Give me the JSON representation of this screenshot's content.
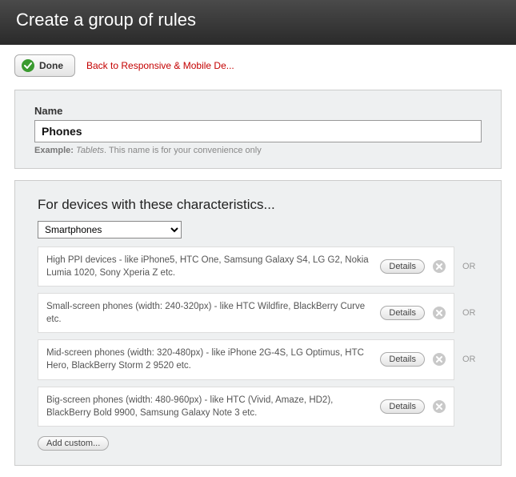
{
  "header": {
    "title": "Create a group of rules"
  },
  "toolbar": {
    "done_label": "Done",
    "back_label": "Back to Responsive & Mobile De..."
  },
  "name_panel": {
    "label": "Name",
    "value": "Phones",
    "hint_prefix": "Example:",
    "hint_example": "Tablets",
    "hint_suffix": ". This name is for your convenience only"
  },
  "devices_panel": {
    "title": "For devices with these characteristics...",
    "preset_selected": "Smartphones",
    "details_label": "Details",
    "or_label": "OR",
    "add_custom_label": "Add custom...",
    "rules": [
      {
        "text": "High PPI devices - like iPhone5, HTC One, Samsung Galaxy S4, LG G2, Nokia Lumia 1020, Sony Xperia Z etc."
      },
      {
        "text": "Small-screen phones (width: 240-320px) - like HTC Wildfire, BlackBerry Curve etc."
      },
      {
        "text": "Mid-screen phones (width: 320-480px) - like iPhone 2G-4S, LG Optimus, HTC Hero, BlackBerry Storm 2 9520 etc."
      },
      {
        "text": "Big-screen phones (width: 480-960px) - like HTC (Vivid, Amaze, HD2), BlackBerry Bold 9900, Samsung Galaxy Note 3 etc."
      }
    ]
  }
}
